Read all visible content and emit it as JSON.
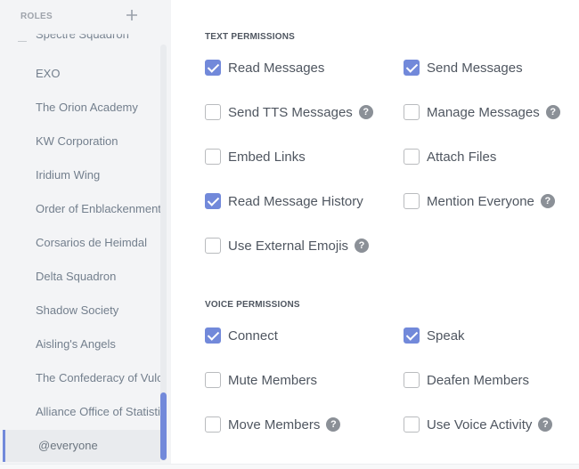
{
  "sidebar": {
    "header": "ROLES",
    "add_icon": "plus-icon",
    "roles": [
      "Spectre Squadron",
      "EXO",
      "The Orion Academy",
      "KW Corporation",
      "Iridium Wing",
      "Order of Enblackenment",
      "Corsarios de Heimdal",
      "Delta Squadron",
      "Shadow Society",
      "Aisling's Angels",
      "The Confederacy of Vulcan",
      "Alliance Office of Statistics",
      "@everyone"
    ],
    "selected_role": "@everyone"
  },
  "text_permissions": {
    "title": "TEXT PERMISSIONS",
    "items": [
      {
        "label": "Read Messages",
        "checked": true,
        "help": false
      },
      {
        "label": "Send Messages",
        "checked": true,
        "help": false
      },
      {
        "label": "Send TTS Messages",
        "checked": false,
        "help": true
      },
      {
        "label": "Manage Messages",
        "checked": false,
        "help": true
      },
      {
        "label": "Embed Links",
        "checked": false,
        "help": false
      },
      {
        "label": "Attach Files",
        "checked": false,
        "help": false
      },
      {
        "label": "Read Message History",
        "checked": true,
        "help": false
      },
      {
        "label": "Mention Everyone",
        "checked": false,
        "help": true
      },
      {
        "label": "Use External Emojis",
        "checked": false,
        "help": true
      }
    ]
  },
  "voice_permissions": {
    "title": "VOICE PERMISSIONS",
    "items": [
      {
        "label": "Connect",
        "checked": true,
        "help": false
      },
      {
        "label": "Speak",
        "checked": true,
        "help": false
      },
      {
        "label": "Mute Members",
        "checked": false,
        "help": false
      },
      {
        "label": "Deafen Members",
        "checked": false,
        "help": false
      },
      {
        "label": "Move Members",
        "checked": false,
        "help": true
      },
      {
        "label": "Use Voice Activity",
        "checked": false,
        "help": true
      }
    ]
  },
  "help_glyph": "?",
  "colors": {
    "accent": "#7289da",
    "sidebar_bg": "#f3f4f6",
    "text": "#4f5660",
    "muted": "#737f8d"
  }
}
